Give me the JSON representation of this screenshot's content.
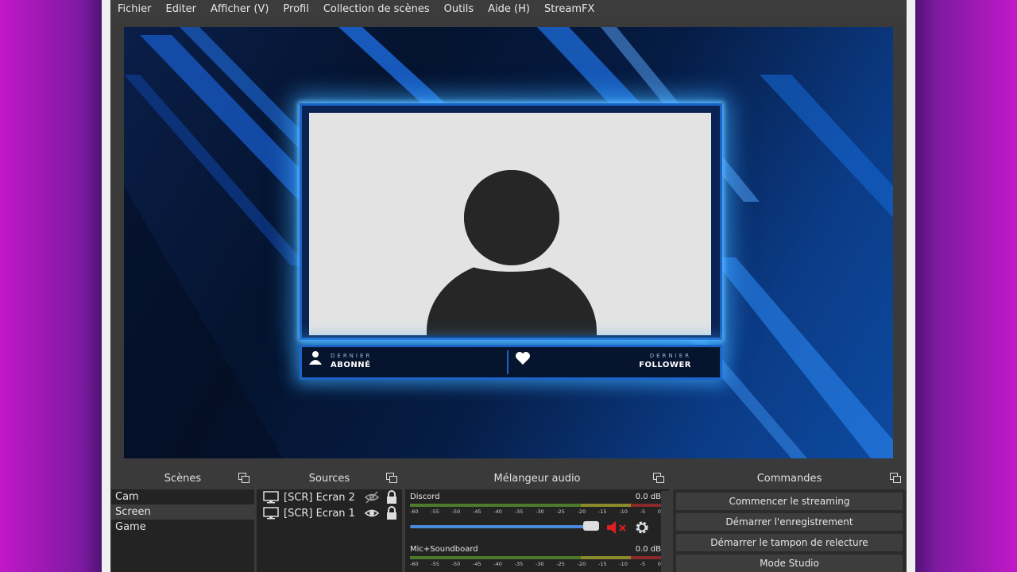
{
  "menu": [
    "Fichier",
    "Editer",
    "Afficher (V)",
    "Profil",
    "Collection de scènes",
    "Outils",
    "Aide (H)",
    "StreamFX"
  ],
  "overlay": {
    "left_small": "DERNIER",
    "left_big": "ABONNÉ",
    "right_small": "DERNIER",
    "right_big": "FOLLOWER"
  },
  "docks": {
    "scenes": {
      "title": "Scènes",
      "items": [
        {
          "label": "Cam",
          "selected": false
        },
        {
          "label": "Screen",
          "selected": true
        },
        {
          "label": "Game",
          "selected": false
        }
      ]
    },
    "sources": {
      "title": "Sources",
      "items": [
        {
          "label": "[SCR] Ecran 2",
          "visible": false,
          "locked": true
        },
        {
          "label": "[SCR] Ecran 1",
          "visible": true,
          "locked": true
        }
      ]
    },
    "mixer": {
      "title": "Mélangeur audio",
      "ticks": [
        "-60",
        "-55",
        "-50",
        "-45",
        "-40",
        "-35",
        "-30",
        "-25",
        "-20",
        "-15",
        "-10",
        "-5",
        "0"
      ],
      "tracks": [
        {
          "name": "Discord",
          "db": "0.0 dB",
          "muted": true,
          "level": 1.0
        },
        {
          "name": "Mic+Soundboard",
          "db": "0.0 dB",
          "muted": false,
          "level": 1.0
        }
      ]
    },
    "commands": {
      "title": "Commandes",
      "buttons": [
        "Commencer le streaming",
        "Démarrer l'enregistrement",
        "Démarrer le tampon de relecture",
        "Mode Studio"
      ]
    }
  },
  "colors": {
    "accent_blue": "#1a63c8",
    "glow": "#3caaff",
    "mute_red": "#e01e1e"
  }
}
